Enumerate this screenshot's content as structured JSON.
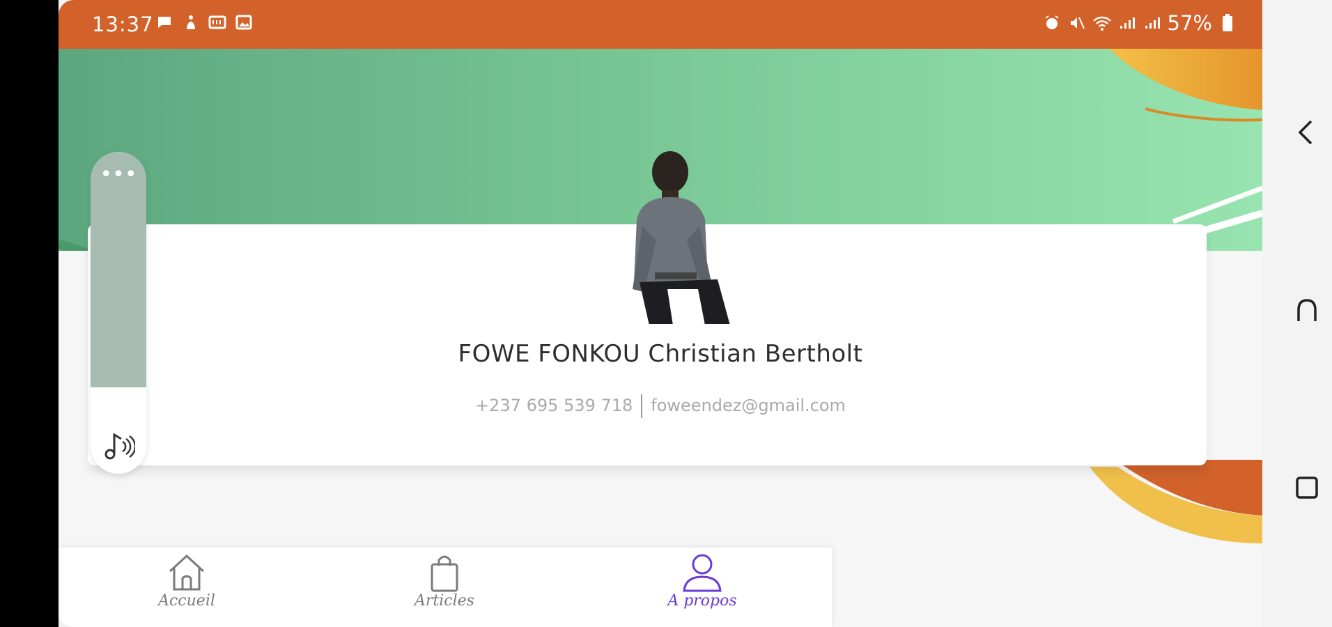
{
  "status_bar": {
    "time": "13:37",
    "battery_text": "57%",
    "left_icons": [
      "chat-icon",
      "accessibility-icon",
      "cast-icon",
      "image-icon"
    ],
    "right_icons": [
      "alarm-icon",
      "mute-icon",
      "wifi-icon",
      "signal-icon",
      "signal-icon"
    ]
  },
  "profile": {
    "name": "FOWE FONKOU Christian Bertholt",
    "phone": "+237 695 539 718",
    "email": "foweendez@gmail.com"
  },
  "floating_panel": {
    "more_label": "•••"
  },
  "bottom_nav": {
    "tabs": [
      {
        "label": "Accueil",
        "icon": "home-icon"
      },
      {
        "label": "Articles",
        "icon": "bag-icon"
      },
      {
        "label": "A propos",
        "icon": "person-icon",
        "active": true
      }
    ]
  },
  "colors": {
    "status_bar": "#d2622a",
    "accent": "#6a3bd3",
    "banner_start": "#5da77f",
    "banner_end": "#98e4b0"
  }
}
